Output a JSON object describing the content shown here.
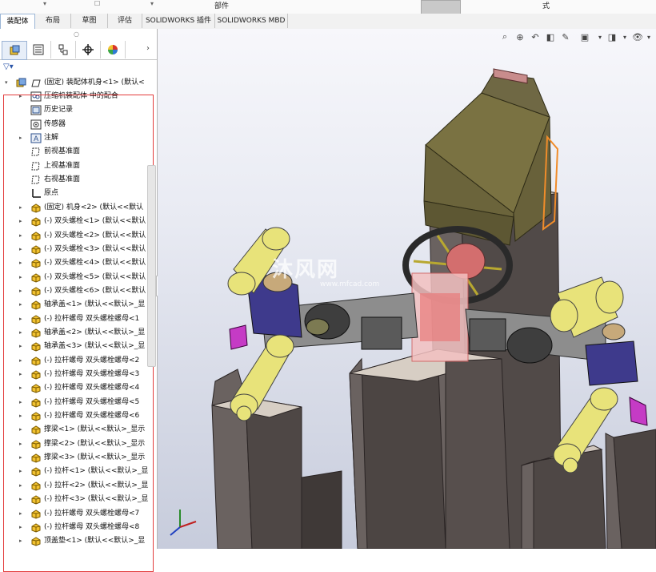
{
  "top_strip": {
    "label_1": "部件",
    "label_2": "式"
  },
  "tabs": [
    {
      "label": "装配体"
    },
    {
      "label": "布局"
    },
    {
      "label": "草图"
    },
    {
      "label": "评估"
    },
    {
      "label": "SOLIDWORKS 插件"
    },
    {
      "label": "SOLIDWORKS MBD"
    }
  ],
  "panel_tabs": [
    {
      "icon": "feature-manager-icon"
    },
    {
      "icon": "property-manager-icon"
    },
    {
      "icon": "configuration-manager-icon"
    },
    {
      "icon": "dimxpert-icon"
    },
    {
      "icon": "display-manager-icon"
    }
  ],
  "tree": {
    "root": "(固定) 装配体机身<1> (默认<",
    "items": [
      {
        "label": "压缩机装配体 中的配合",
        "icon": "mates-icon",
        "expandable": true
      },
      {
        "label": "历史记录",
        "icon": "history-icon",
        "expandable": false
      },
      {
        "label": "传感器",
        "icon": "sensor-icon",
        "expandable": false
      },
      {
        "label": "注解",
        "icon": "annotation-icon",
        "expandable": true
      },
      {
        "label": "前视基准面",
        "icon": "plane-icon",
        "expandable": false
      },
      {
        "label": "上视基准面",
        "icon": "plane-icon",
        "expandable": false
      },
      {
        "label": "右视基准面",
        "icon": "plane-icon",
        "expandable": false
      },
      {
        "label": "原点",
        "icon": "origin-icon",
        "expandable": false
      },
      {
        "label": "(固定) 机身<2> (默认<<默认",
        "icon": "part-icon",
        "expandable": true
      },
      {
        "label": "(-) 双头螺栓<1> (默认<<默认",
        "icon": "part-icon",
        "expandable": true
      },
      {
        "label": "(-) 双头螺栓<2> (默认<<默认",
        "icon": "part-icon",
        "expandable": true
      },
      {
        "label": "(-) 双头螺栓<3> (默认<<默认",
        "icon": "part-icon",
        "expandable": true
      },
      {
        "label": "(-) 双头螺栓<4> (默认<<默认",
        "icon": "part-icon",
        "expandable": true
      },
      {
        "label": "(-) 双头螺栓<5> (默认<<默认",
        "icon": "part-icon",
        "expandable": true
      },
      {
        "label": "(-) 双头螺栓<6> (默认<<默认",
        "icon": "part-icon",
        "expandable": true
      },
      {
        "label": "轴承盖<1> (默认<<默认>_显",
        "icon": "part-icon",
        "expandable": true
      },
      {
        "label": "(-) 拉杆螺母 双头螺栓螺母<1",
        "icon": "part-icon",
        "expandable": true
      },
      {
        "label": "轴承盖<2> (默认<<默认>_显",
        "icon": "part-icon",
        "expandable": true
      },
      {
        "label": "轴承盖<3> (默认<<默认>_显",
        "icon": "part-icon",
        "expandable": true
      },
      {
        "label": "(-) 拉杆螺母 双头螺栓螺母<2",
        "icon": "part-icon",
        "expandable": true
      },
      {
        "label": "(-) 拉杆螺母 双头螺栓螺母<3",
        "icon": "part-icon",
        "expandable": true
      },
      {
        "label": "(-) 拉杆螺母 双头螺栓螺母<4",
        "icon": "part-icon",
        "expandable": true
      },
      {
        "label": "(-) 拉杆螺母 双头螺栓螺母<5",
        "icon": "part-icon",
        "expandable": true
      },
      {
        "label": "(-) 拉杆螺母 双头螺栓螺母<6",
        "icon": "part-icon",
        "expandable": true
      },
      {
        "label": "撑梁<1> (默认<<默认>_显示",
        "icon": "part-icon",
        "expandable": true
      },
      {
        "label": "撑梁<2> (默认<<默认>_显示",
        "icon": "part-icon",
        "expandable": true
      },
      {
        "label": "撑梁<3> (默认<<默认>_显示",
        "icon": "part-icon",
        "expandable": true
      },
      {
        "label": "(-) 拉杆<1> (默认<<默认>_显",
        "icon": "part-icon",
        "expandable": true
      },
      {
        "label": "(-) 拉杆<2> (默认<<默认>_显",
        "icon": "part-icon",
        "expandable": true
      },
      {
        "label": "(-) 拉杆<3> (默认<<默认>_显",
        "icon": "part-icon",
        "expandable": true
      },
      {
        "label": "(-) 拉杆螺母 双头螺栓螺母<7",
        "icon": "part-icon",
        "expandable": true
      },
      {
        "label": "(-) 拉杆螺母 双头螺栓螺母<8",
        "icon": "part-icon",
        "expandable": true
      },
      {
        "label": "顶盖垫<1> (默认<<默认>_显",
        "icon": "part-icon",
        "expandable": true
      }
    ]
  },
  "viewport": {
    "watermark": "沐风网",
    "watermark_url": "www.mfcad.com",
    "toolbar_icons": [
      "zoom-to-fit-icon",
      "zoom-area-icon",
      "previous-view-icon",
      "section-view-icon",
      "dynamic-annotation-icon",
      "view-orientation-icon",
      "display-style-icon",
      "hide-show-icon"
    ],
    "colors": {
      "motor": "#6f6a3a",
      "cylinder": "#e8e37a",
      "frame": "#4f4846",
      "crosshead": "#3e3a8c",
      "highlight": "#f08c2a"
    }
  }
}
